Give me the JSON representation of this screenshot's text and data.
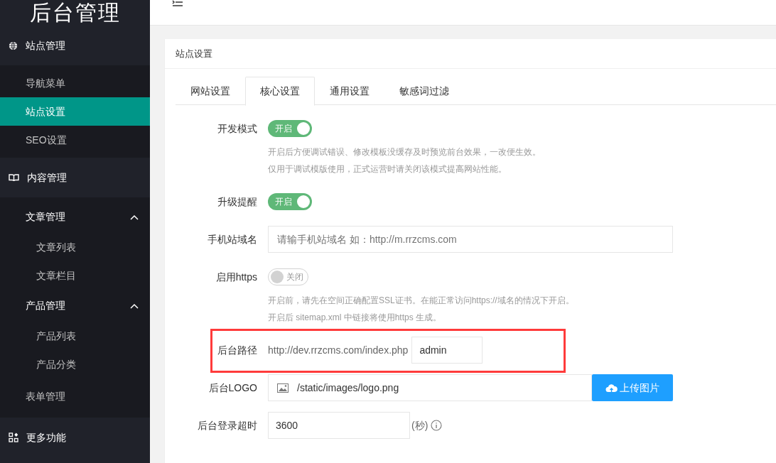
{
  "logo": "后台管理",
  "sidebar": [
    {
      "label": "站点管理",
      "children": [
        {
          "label": "导航菜单",
          "selected": false
        },
        {
          "label": "站点设置",
          "selected": true
        },
        {
          "label": "SEO设置",
          "selected": false
        }
      ]
    },
    {
      "label": "内容管理",
      "children": [
        {
          "label": "文章管理",
          "expanded": true,
          "children": [
            {
              "label": "文章列表",
              "selected": false
            },
            {
              "label": "文章栏目",
              "selected": false
            }
          ]
        },
        {
          "label": "产品管理",
          "expanded": true,
          "children": [
            {
              "label": "产品列表",
              "selected": false
            },
            {
              "label": "产品分类",
              "selected": false
            }
          ]
        },
        {
          "label": "表单管理",
          "selected": false
        }
      ]
    },
    {
      "label": "更多功能"
    }
  ],
  "card_title": "站点设置",
  "tabs": [
    {
      "label": "网站设置",
      "selected": false
    },
    {
      "label": "核心设置",
      "selected": true
    },
    {
      "label": "通用设置",
      "selected": false
    },
    {
      "label": "敏感词过滤",
      "selected": false
    }
  ],
  "form": [
    {
      "kind": "toggle",
      "label": "开发模式",
      "on": true,
      "text": "开启",
      "help": [
        "开启后方便调试错误、修改模板没缓存及时预览前台效果，一改便生效。",
        "仅用于调试模版使用，正式运营时请关闭该模式提高网站性能。"
      ]
    },
    {
      "kind": "toggle",
      "label": "升级提醒",
      "on": true,
      "text": "开启"
    },
    {
      "kind": "input",
      "label": "手机站域名",
      "placeholder": "请输手机站域名 如：http://m.rrzcms.com"
    },
    {
      "kind": "toggle",
      "label": "启用https",
      "on": false,
      "text": "关闭",
      "help": [
        "开启前，请先在空间正确配置SSL证书。在能正常访问https://域名的情况下开启。",
        "开启后 sitemap.xml 中链接将使用https 生成。"
      ]
    },
    {
      "kind": "path",
      "label": "后台路径",
      "prefix": "http://dev.rrzcms.com/index.php",
      "value": "admin",
      "highlighted": true
    },
    {
      "kind": "upload",
      "label": "后台LOGO",
      "value": "/static/images/logo.png",
      "button": "上传图片"
    },
    {
      "kind": "number",
      "label": "后台登录超时",
      "value": "3600",
      "unit": "(秒)"
    }
  ]
}
